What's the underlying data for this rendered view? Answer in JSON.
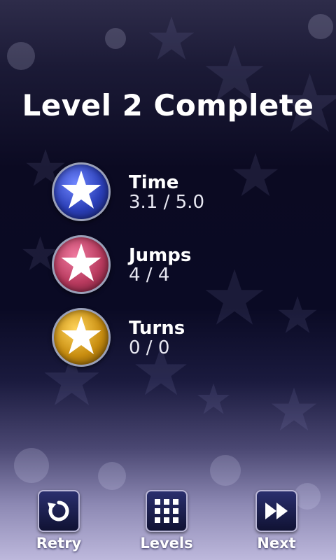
{
  "screen": {
    "title": "Level 2 Complete"
  },
  "stats": [
    {
      "label": "Time",
      "value": "3.1 / 5.0",
      "icon": "star-icon",
      "orb_color": "#3a4fd0"
    },
    {
      "label": "Jumps",
      "value": "4 / 4",
      "icon": "star-icon",
      "orb_color": "#c24a6e"
    },
    {
      "label": "Turns",
      "value": "0 / 0",
      "icon": "star-icon",
      "orb_color": "#d9a21c"
    }
  ],
  "buttons": {
    "retry": {
      "label": "Retry",
      "icon": "retry-icon"
    },
    "levels": {
      "label": "Levels",
      "icon": "grid-icon"
    },
    "next": {
      "label": "Next",
      "icon": "fast-forward-icon"
    }
  }
}
